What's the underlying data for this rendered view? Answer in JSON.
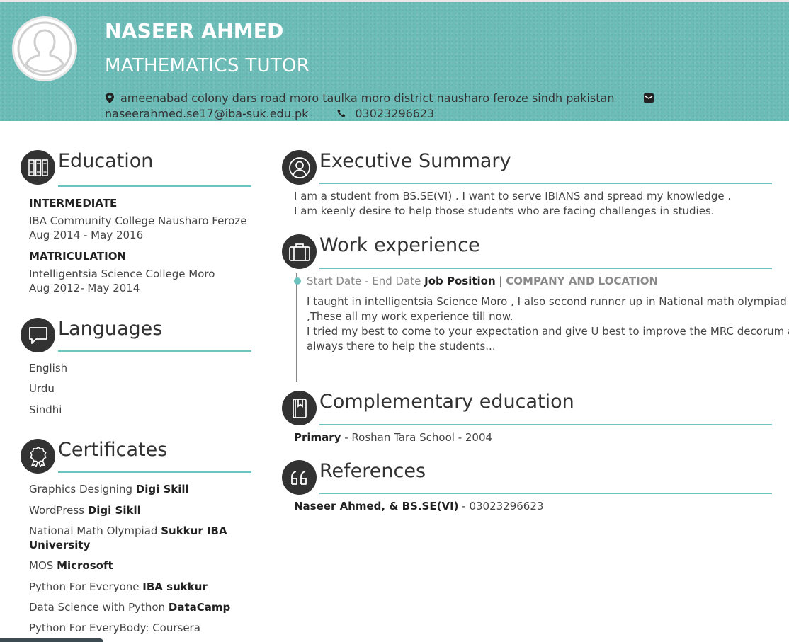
{
  "header": {
    "name": "NASEER AHMED",
    "title": "MATHEMATICS TUTOR",
    "address": "ameenabad colony dars road moro taulka moro district nausharo feroze sindh pakistan",
    "email": "naseerahmed.se17@iba-suk.edu.pk",
    "phone": "03023296623",
    "colors": {
      "accent": "#6cc4c0",
      "header_bg": "#6cbcb8",
      "icon_bg": "#323232"
    }
  },
  "education": {
    "title": "Education",
    "icon": "books-icon",
    "items": [
      {
        "degree": "INTERMEDIATE",
        "school": "IBA Community College Nausharo Feroze",
        "dates": "Aug 2014 - May 2016"
      },
      {
        "degree": "MATRICULATION",
        "school": "Intelligentsia Science College Moro",
        "dates": "Aug 2012- May 2014"
      }
    ]
  },
  "languages": {
    "title": "Languages",
    "icon": "speech-bubble-icon",
    "items": [
      "English",
      "Urdu",
      "Sindhi"
    ]
  },
  "certificates": {
    "title": "Certificates",
    "icon": "award-ribbon-icon",
    "items": [
      {
        "name": "Graphics Designing",
        "issuer": "Digi Skill"
      },
      {
        "name": "WordPress",
        "issuer": "Digi Sikll"
      },
      {
        "name": "National Math Olympiad",
        "issuer": "Sukkur IBA",
        "issuer_line2": "University"
      },
      {
        "name": "MOS",
        "issuer": "Microsoft"
      },
      {
        "name": "Python For Everyone",
        "issuer": "IBA sukkur"
      },
      {
        "name": "Data Science with Python",
        "issuer": "DataCamp"
      },
      {
        "name": "Python For EveryBody: Coursera",
        "issuer": ""
      }
    ]
  },
  "summary": {
    "title": "Executive Summary",
    "icon": "user-icon",
    "lines": [
      "I am a student from BS.SE(VI) . I want to serve IBIANS and spread my knowledge .",
      "I am keenly desire to help those students who are facing challenges in studies."
    ]
  },
  "work": {
    "title": "Work experience",
    "icon": "briefcase-icon",
    "dates": "Start Date - End Date",
    "position": "Job Position",
    "separator": "|",
    "company": "COMPANY AND LOCATION",
    "lines": [
      "I taught in intelligentsia Science Moro , I also second runner up in National math olympiad",
      ",These all my work experience till now.",
      "I tried my best to come to your expectation and give U best to improve the MRC decorum and",
      "always there to help the students..."
    ]
  },
  "complementary": {
    "title": "Complementary education",
    "icon": "bookmark-book-icon",
    "level": "Primary",
    "detail": " - Roshan Tara School - 2004"
  },
  "references": {
    "title": "References",
    "icon": "quote-icon",
    "name": "Naseer Ahmed, & BS.SE(VI)",
    "detail": " - 03023296623"
  }
}
